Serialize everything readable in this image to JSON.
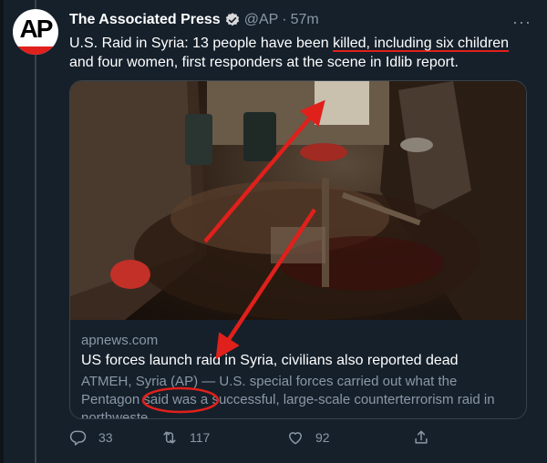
{
  "tweet": {
    "author_name": "The Associated Press",
    "handle": "@AP",
    "separator": "·",
    "time": "57m",
    "more_label": "···",
    "avatar_text": "AP",
    "text_part1": "U.S. Raid in Syria: 13 people have been ",
    "text_underlined": "killed, including six children",
    "text_part2": " and four women, first responders at the scene in Idlib report."
  },
  "card": {
    "domain": "apnews.com",
    "title": "US forces launch raid in Syria, civilians also reported dead",
    "description_start": "ATMEH, Syria (AP) — U.S. special forces carried out what the Pentagon said was a ",
    "description_circled": "successful",
    "description_end": ", large-scale counterterrorism raid in northweste..."
  },
  "actions": {
    "reply_count": "33",
    "retweet_count": "117",
    "like_count": "92"
  },
  "colors": {
    "background": "#15202b",
    "annotation_red": "#e0201b",
    "muted_text": "#8b98a5"
  }
}
